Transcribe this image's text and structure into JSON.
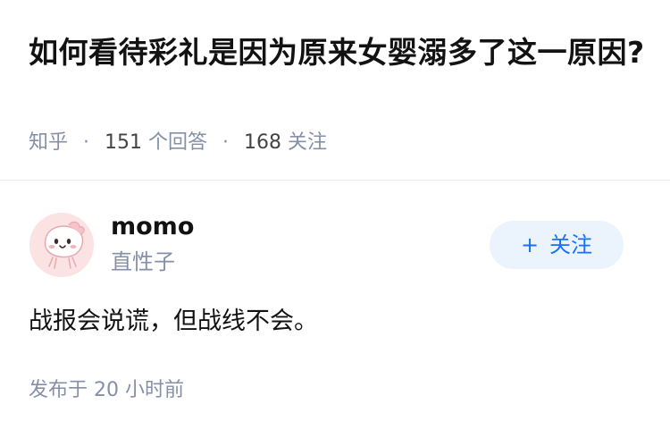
{
  "question": {
    "title": "如何看待彩礼是因为原来女婴溺多了这一原因?",
    "source": "知乎",
    "answer_count": "151",
    "answer_count_label": "个回答",
    "follower_count": "168",
    "follower_count_label": "关注",
    "separator": "·"
  },
  "answer": {
    "author": {
      "name": "momo",
      "bio": "直性子",
      "avatar_icon": "cartoon-face-avatar-icon"
    },
    "follow_button": {
      "plus": "+",
      "label": "关注"
    },
    "content": "战报会说谎，但战线不会。",
    "published_label": "发布于",
    "published_time": "20 小时前"
  },
  "colors": {
    "title_text": "#121212",
    "meta_text": "#8590a6",
    "follow_bg": "#ebf3fc",
    "follow_text": "#1772f6",
    "avatar_bg": "#fbe3e4"
  }
}
